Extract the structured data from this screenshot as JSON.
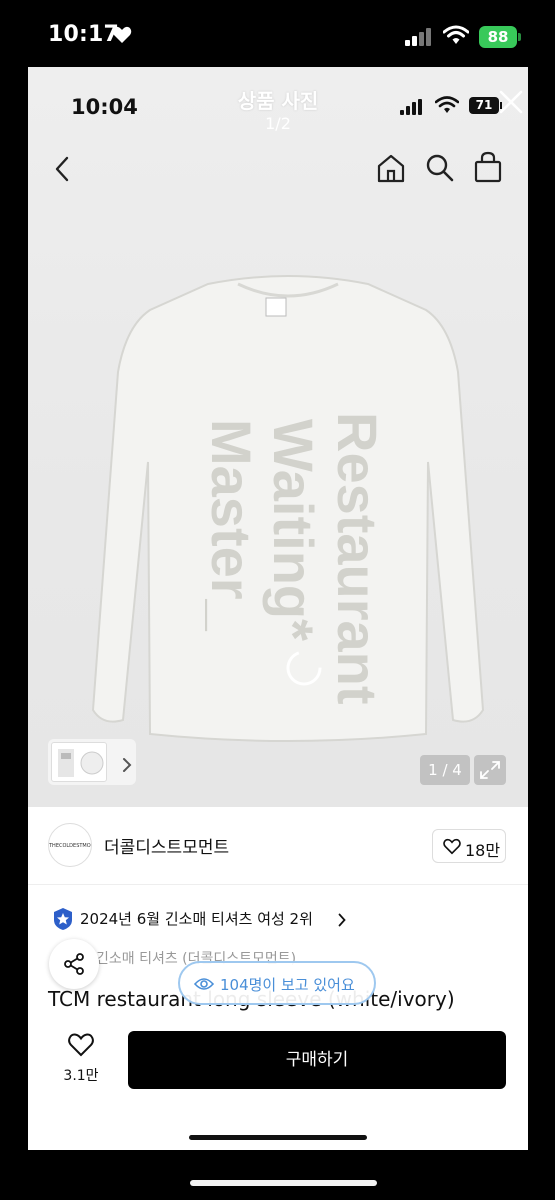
{
  "outer_status": {
    "time": "10:17",
    "battery": "88"
  },
  "inner_status": {
    "time": "10:04",
    "battery": "71"
  },
  "viewer": {
    "title": "상품 사진",
    "counter": "1/2"
  },
  "gallery": {
    "counter": "1 / 4"
  },
  "product_print": [
    "Restaurant",
    "Waiting*",
    "Master_"
  ],
  "shop": {
    "name": "더콜디스트모먼트",
    "logo_text": "THECOLDESTMOMENT",
    "likes": "18만"
  },
  "ranking": {
    "text": "2024년 6월 긴소매 티셔츠 여성 2위"
  },
  "category": "긴소매 티셔츠 (더콜디스트모먼트)",
  "product": {
    "title": "TCM restaurant long sleeve (white/ivory)"
  },
  "viewers": {
    "text": "104명이 보고 있어요"
  },
  "bottom": {
    "wish_count": "3.1만",
    "buy_label": "구매하기"
  },
  "colors": {
    "accent": "#4a8fd8",
    "battery_green": "#38c95a",
    "buy_button": "#000000"
  },
  "icons": [
    "heart-icon",
    "signal-icon",
    "wifi-icon",
    "close-icon",
    "back-icon",
    "home-icon",
    "search-icon",
    "bag-icon",
    "chevron-right-icon",
    "expand-icon",
    "rank-badge-icon",
    "share-icon",
    "eye-icon"
  ]
}
